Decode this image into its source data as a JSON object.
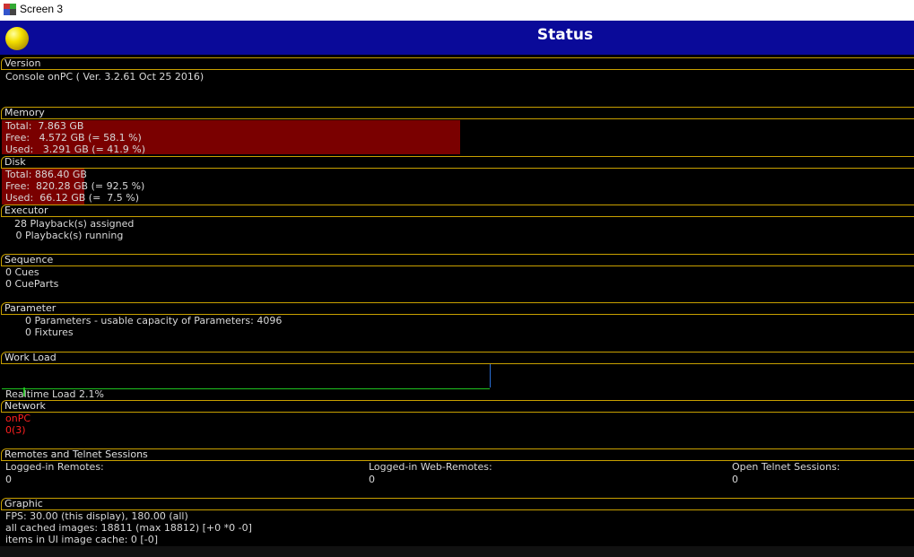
{
  "window": {
    "title": "Screen 3"
  },
  "header": {
    "title": "Status"
  },
  "version": {
    "label": "Version",
    "line": "Console onPC ( Ver. 3.2.61 Oct 25 2016)"
  },
  "memory": {
    "label": "Memory",
    "total": "Total:  7.863 GB",
    "free": "Free:   4.572 GB (= 58.1 %)",
    "used": "Used:   3.291 GB (= 41.9 %)",
    "used_fraction": 0.419
  },
  "disk": {
    "label": "Disk",
    "total": "Total: 886.40 GB",
    "free": "Free:  820.28 GB (= 92.5 %)",
    "used": "Used:  66.12 GB (=  7.5 %)",
    "used_fraction": 0.075
  },
  "executor": {
    "label": "Executor",
    "assigned": "28 Playback(s) assigned",
    "running": " 0 Playback(s) running"
  },
  "sequence": {
    "label": "Sequence",
    "cues": "0 Cues",
    "cueparts": "0 CueParts"
  },
  "parameter": {
    "label": "Parameter",
    "params": "0 Parameters - usable capacity of Parameters: 4096",
    "fixtures": "0 Fixtures"
  },
  "workload": {
    "label": "Work Load",
    "realtime": "Realtime Load 2.1%",
    "load_percent": 2.1
  },
  "network": {
    "label": "Network",
    "line1": "onPC",
    "line2": "0(3)",
    "accent": "#ff2020"
  },
  "remotes": {
    "label": "Remotes and Telnet Sessions",
    "col1_label": "Logged-in Remotes:",
    "col1_value": "0",
    "col2_label": "Logged-in Web-Remotes:",
    "col2_value": "0",
    "col3_label": "Open Telnet Sessions:",
    "col3_value": "0"
  },
  "graphic": {
    "label": "Graphic",
    "fps": "FPS: 30.00 (this display), 180.00 (all)",
    "cached": "all cached images: 18811 (max 18812) [+0 *0 -0]",
    "ui_cache": "items in UI image cache: 0 [-0]"
  },
  "colors": {
    "header_bg": "#0a0a99",
    "frame": "#c8a000",
    "bar_red": "#7a0000"
  }
}
